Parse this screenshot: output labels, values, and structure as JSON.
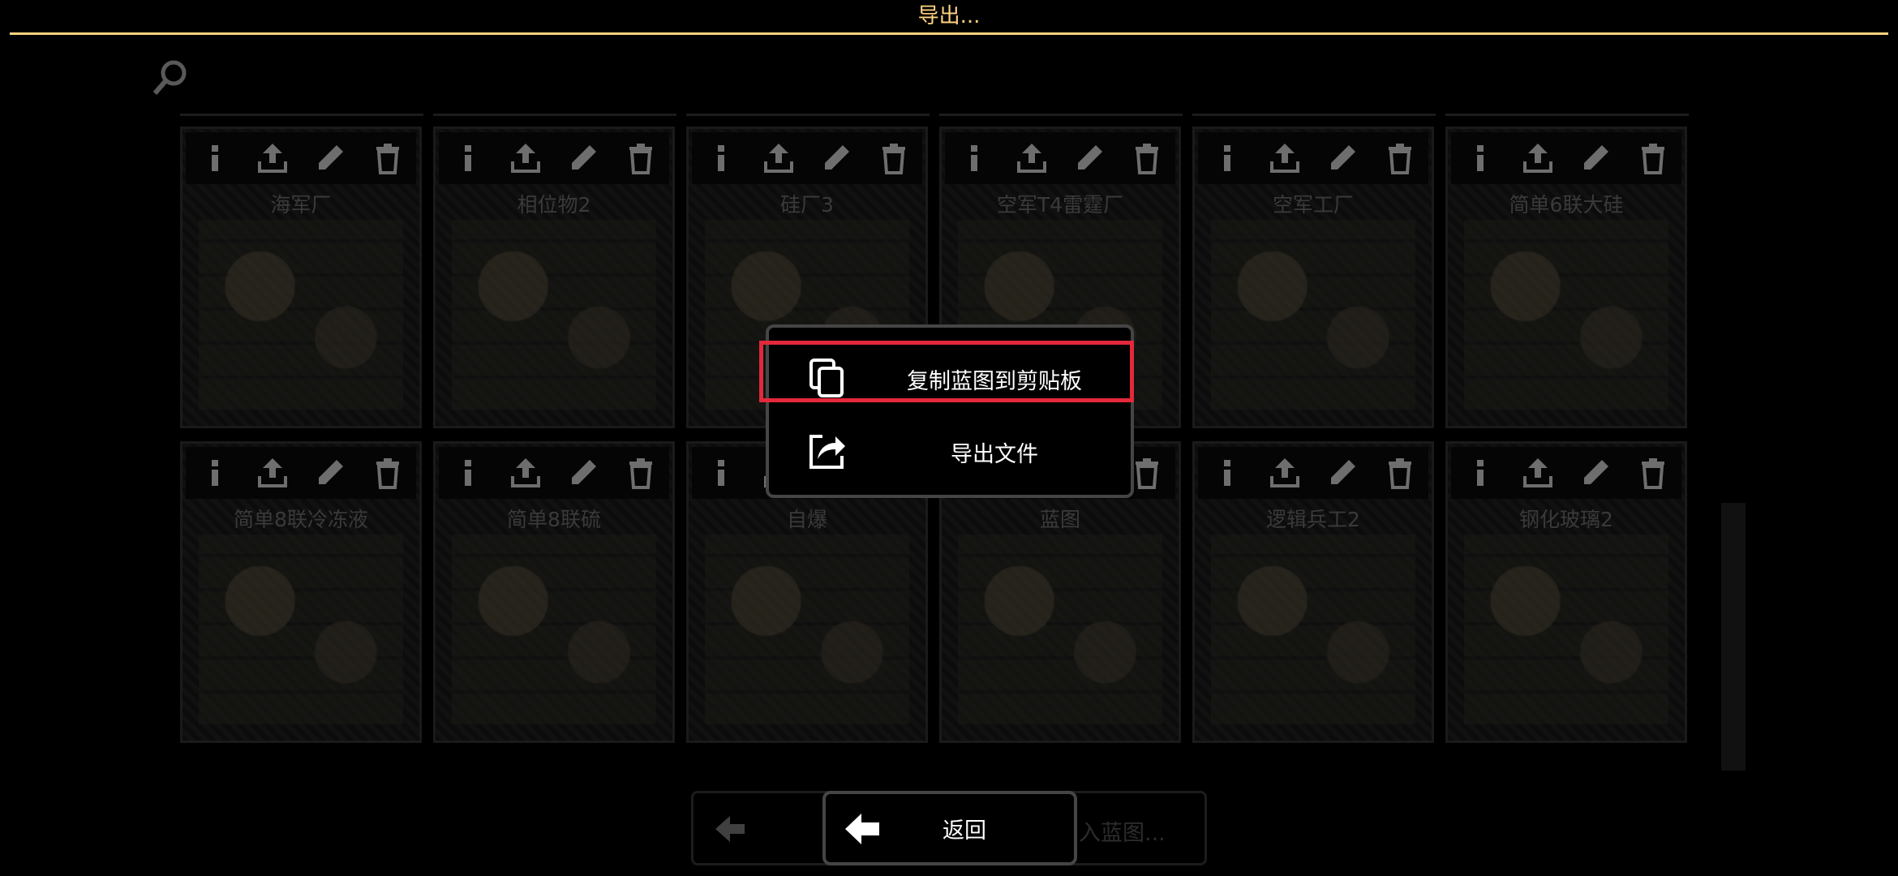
{
  "dialog": {
    "title": "导出..."
  },
  "export_menu": {
    "copy_label": "复制蓝图到剪贴板",
    "copy_icon": "copy-icon",
    "export_file_label": "导出文件",
    "export_file_icon": "share-icon",
    "highlight_color": "#e3283b"
  },
  "footer": {
    "back_label": "返回",
    "import_label": "入蓝图..."
  },
  "blueprints": [
    {
      "name": "海军厂"
    },
    {
      "name": "相位物2"
    },
    {
      "name": "硅厂3"
    },
    {
      "name": "空军T4雷霆厂"
    },
    {
      "name": "空军工厂"
    },
    {
      "name": "简单6联大硅"
    },
    {
      "name": "简单8联冷冻液"
    },
    {
      "name": "简单8联硫"
    },
    {
      "name": "自爆"
    },
    {
      "name": "蓝图"
    },
    {
      "name": "逻辑兵工2"
    },
    {
      "name": "钢化玻璃2"
    }
  ],
  "card_tools": [
    "info-icon",
    "upload-icon",
    "edit-icon",
    "delete-icon"
  ],
  "colors": {
    "accent": "#ffd37f",
    "background": "#000000",
    "border": "#454545"
  }
}
